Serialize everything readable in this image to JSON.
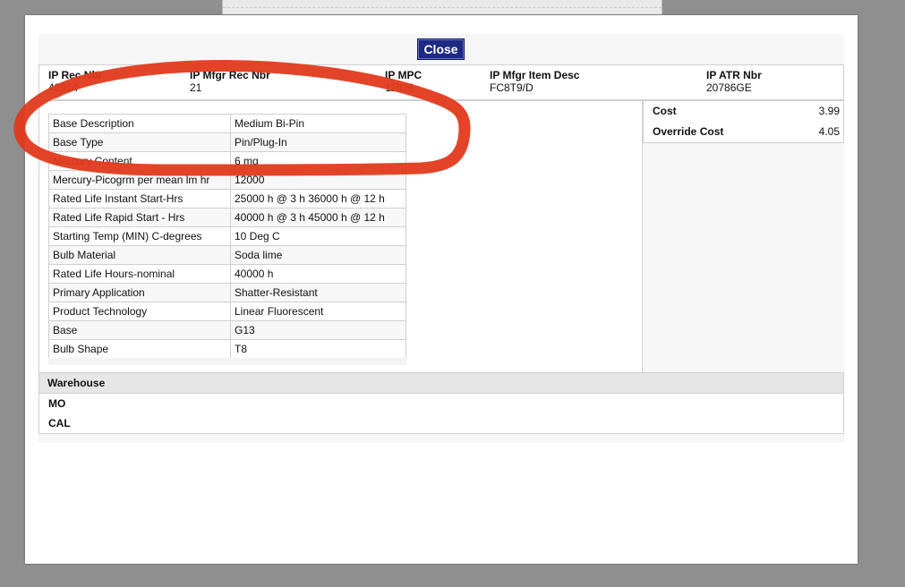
{
  "close_label": "Close",
  "header": {
    "rec_nbr": {
      "label": "IP Rec Nbr",
      "value": "42914"
    },
    "mfgr_rec_nbr": {
      "label": "IP Mfgr Rec Nbr",
      "value": "21"
    },
    "mpc": {
      "label": "IP MPC",
      "value": "11026"
    },
    "mfgr_item_desc": {
      "label": "IP Mfgr Item Desc",
      "value": "FC8T9/D"
    },
    "atr_nbr": {
      "label": "IP ATR Nbr",
      "value": "20786GE"
    }
  },
  "attributes": [
    {
      "key": "Base Description",
      "value": "Medium Bi-Pin"
    },
    {
      "key": "Base Type",
      "value": "Pin/Plug-In"
    },
    {
      "key": "Mercury Content",
      "value": "6 mg"
    },
    {
      "key": "Mercury-Picogrm per mean lm hr",
      "value": "12000"
    },
    {
      "key": "Rated Life Instant Start-Hrs",
      "value": "25000 h @ 3 h 36000 h @ 12 h"
    },
    {
      "key": "Rated Life Rapid Start - Hrs",
      "value": "40000 h @ 3 h 45000 h @ 12 h"
    },
    {
      "key": "Starting Temp (MIN) C-degrees",
      "value": "10 Deg C"
    },
    {
      "key": "Bulb Material",
      "value": "Soda lime"
    },
    {
      "key": "Rated Life Hours-nominal",
      "value": "40000 h"
    },
    {
      "key": "Primary Application",
      "value": "Shatter-Resistant"
    },
    {
      "key": "Product Technology",
      "value": "Linear Fluorescent"
    },
    {
      "key": "Base",
      "value": "G13"
    },
    {
      "key": "Bulb Shape",
      "value": "T8"
    }
  ],
  "cost": {
    "cost_label": "Cost",
    "cost_value": "3.99",
    "override_label": "Override Cost",
    "override_value": "4.05"
  },
  "warehouse": {
    "title": "Warehouse",
    "items": [
      "MO",
      "CAL"
    ]
  },
  "colors": {
    "close_button": "#1d2a82",
    "annotation_stroke": "#e23a1c",
    "overlay": "#8f8f8f"
  }
}
